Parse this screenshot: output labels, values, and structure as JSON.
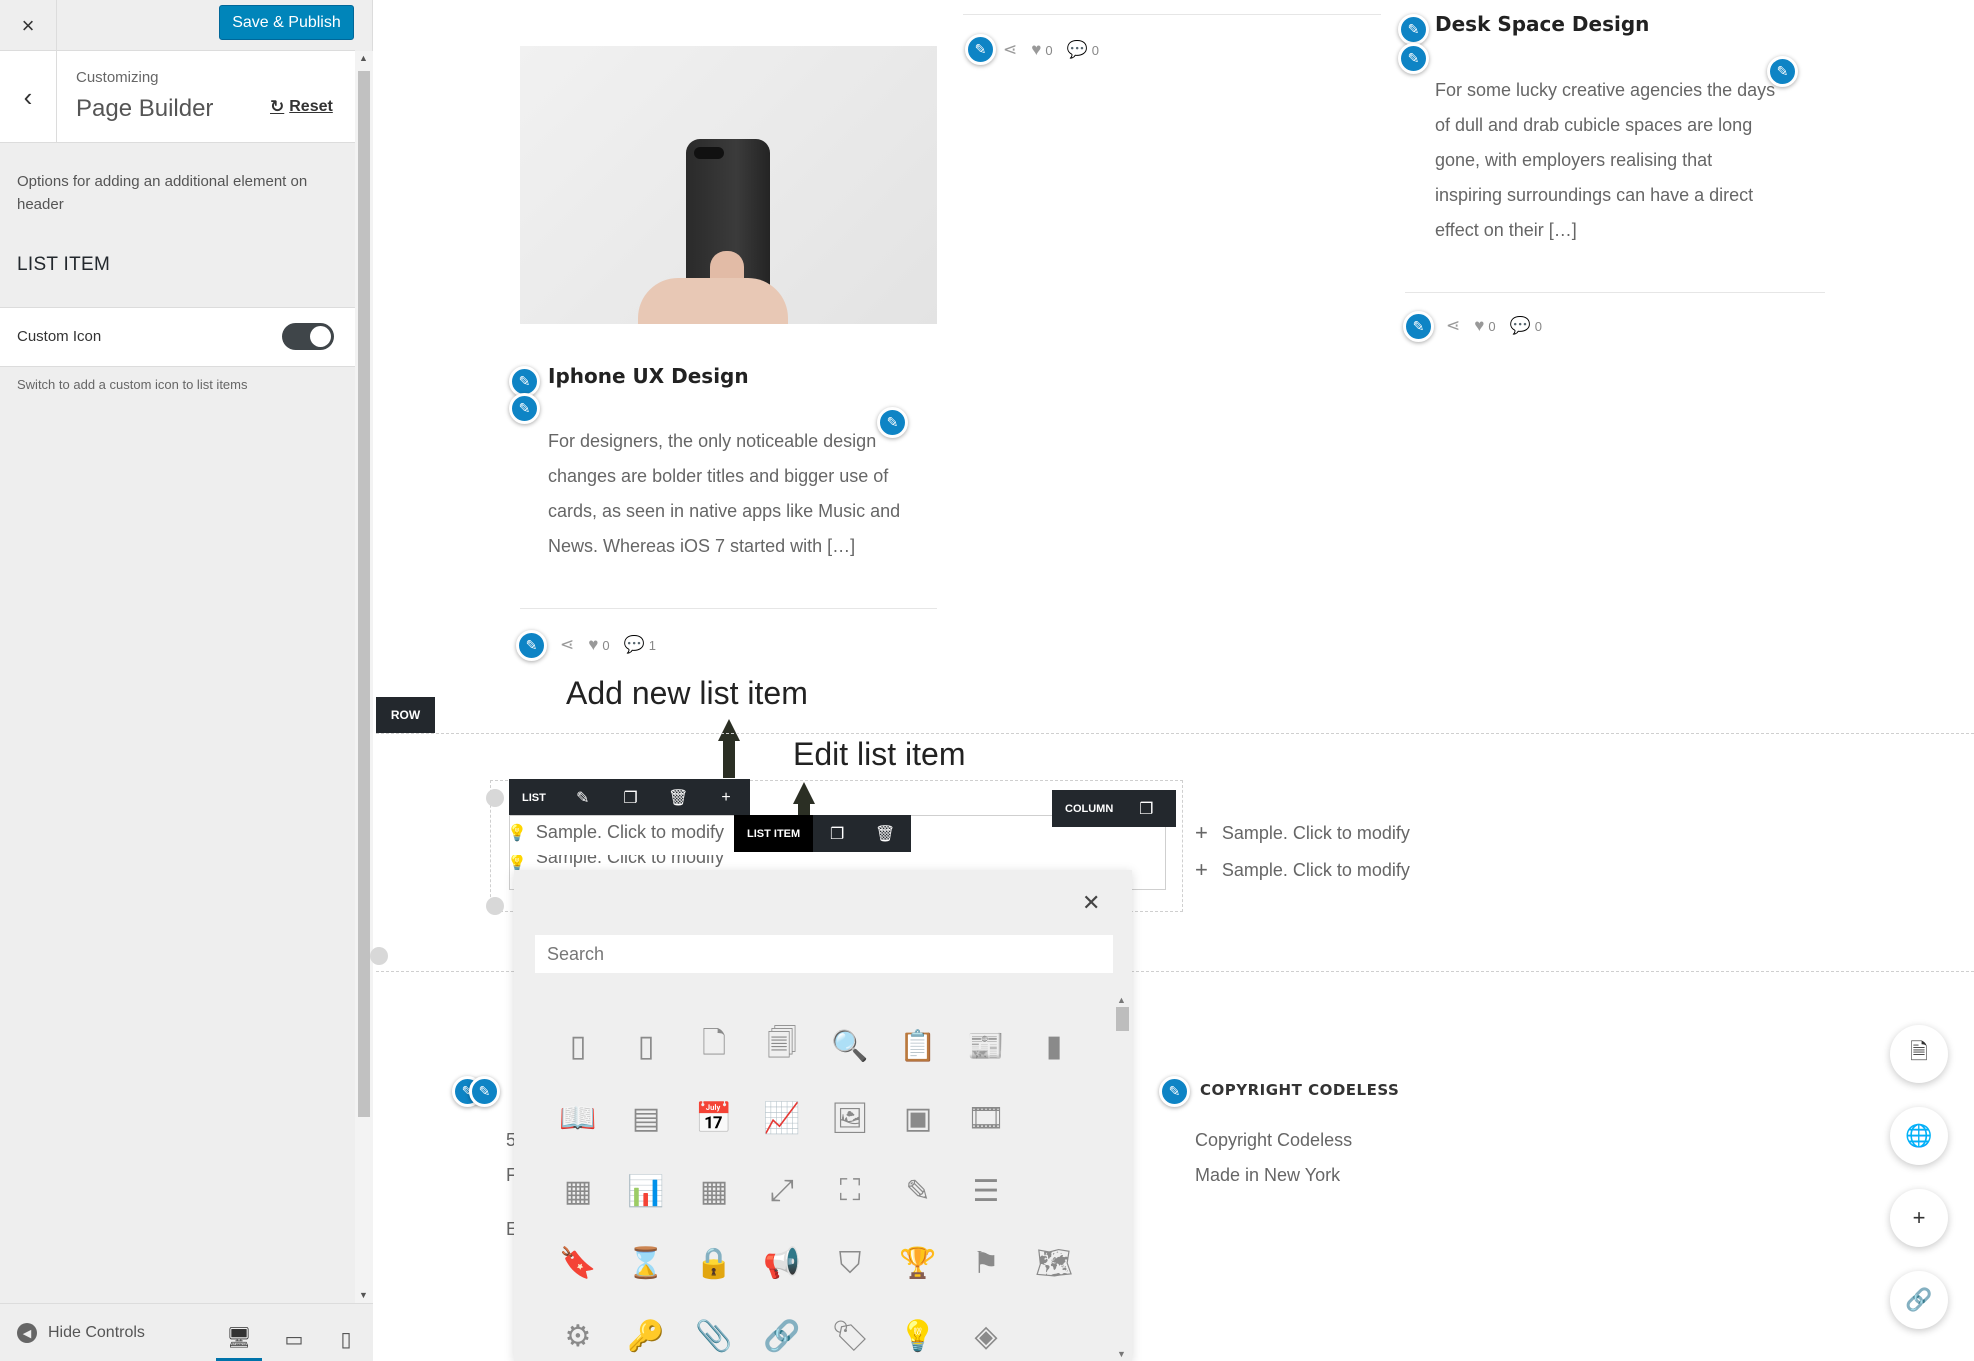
{
  "sidebar": {
    "close_icon": "×",
    "publish_label": "Save & Publish",
    "back_icon": "‹",
    "customizing_label": "Customizing",
    "page_title": "Page Builder",
    "reset_label": "Reset",
    "description": "Options for adding an additional element on header",
    "section_title": "LIST ITEM",
    "option_label": "Custom Icon",
    "option_enabled": true,
    "option_help": "Switch to add a custom icon to list items",
    "hide_controls_label": "Hide Controls",
    "devices": [
      "desktop",
      "tablet",
      "mobile"
    ],
    "active_device": "desktop"
  },
  "posts": [
    {
      "title": "Iphone UX Design",
      "excerpt_lines": [
        "For designers, the only noticeable design",
        "changes are bolder titles and bigger use of",
        "cards, as seen in native apps like Music and",
        "News. Whereas iOS 7 started with […]"
      ],
      "likes": "0",
      "comments": "1"
    },
    {
      "title": "Desk Space Design",
      "excerpt_lines": [
        "For some lucky creative agencies the days",
        "of dull and drab cubicle spaces are long",
        "gone, with employers realising that",
        "inspiring surroundings can have a direct",
        "effect on their […]"
      ],
      "likes": "0",
      "comments": "0"
    },
    {
      "likes": "0",
      "comments": "0"
    }
  ],
  "annotations": {
    "add": "Add new list item",
    "edit": "Edit list item"
  },
  "builder": {
    "row_label": "ROW",
    "list_label": "LIST",
    "list_item_label": "LIST ITEM",
    "column_label": "COLUMN",
    "list_items": [
      "Sample. Click to modify",
      "Sample. Click to modify"
    ],
    "column_items": [
      "Sample. Click to modify",
      "Sample. Click to modify"
    ]
  },
  "icon_picker": {
    "search_placeholder": "Search",
    "icons": [
      {
        "name": "tablet-icon",
        "glyph": "▯"
      },
      {
        "name": "mobile-icon",
        "glyph": "▯"
      },
      {
        "name": "document-icon",
        "glyph": "🗋"
      },
      {
        "name": "documents-icon",
        "glyph": "🗐"
      },
      {
        "name": "document-search-icon",
        "glyph": "🔍"
      },
      {
        "name": "clipboard-icon",
        "glyph": "📋"
      },
      {
        "name": "newspaper-icon",
        "glyph": "📰"
      },
      {
        "name": "notebook-icon",
        "glyph": "▮"
      },
      {
        "name": "book-icon",
        "glyph": "📖"
      },
      {
        "name": "browser-icon",
        "glyph": "▤"
      },
      {
        "name": "calendar-icon",
        "glyph": "📅"
      },
      {
        "name": "presentation-icon",
        "glyph": "📈"
      },
      {
        "name": "image-icon",
        "glyph": "🖼"
      },
      {
        "name": "images-icon",
        "glyph": "▣"
      },
      {
        "name": "video-icon",
        "glyph": "🎞"
      },
      {
        "name": "",
        "glyph": ""
      },
      {
        "name": "blueprint-icon",
        "glyph": "▦"
      },
      {
        "name": "bar-chart-icon",
        "glyph": "📊"
      },
      {
        "name": "table-icon",
        "glyph": "▦"
      },
      {
        "name": "expand-icon",
        "glyph": "⤢"
      },
      {
        "name": "focus-icon",
        "glyph": "⛶"
      },
      {
        "name": "edit-icon",
        "glyph": "✎"
      },
      {
        "name": "sliders-icon",
        "glyph": "☰"
      },
      {
        "name": "",
        "glyph": ""
      },
      {
        "name": "bookmark-icon",
        "glyph": "🔖"
      },
      {
        "name": "hourglass-icon",
        "glyph": "⌛"
      },
      {
        "name": "lock-icon",
        "glyph": "🔒"
      },
      {
        "name": "megaphone-icon",
        "glyph": "📢"
      },
      {
        "name": "shield-icon",
        "glyph": "⛉"
      },
      {
        "name": "trophy-icon",
        "glyph": "🏆"
      },
      {
        "name": "flag-icon",
        "glyph": "⚑"
      },
      {
        "name": "map-icon",
        "glyph": "🗺"
      },
      {
        "name": "gears-icon",
        "glyph": "⚙"
      },
      {
        "name": "key-icon",
        "glyph": "🔑"
      },
      {
        "name": "paperclip-icon",
        "glyph": "📎"
      },
      {
        "name": "link-icon",
        "glyph": "🔗"
      },
      {
        "name": "tags-icon",
        "glyph": "🏷"
      },
      {
        "name": "lightbulb-icon",
        "glyph": "💡"
      },
      {
        "name": "layers-icon",
        "glyph": "◈"
      },
      {
        "name": "",
        "glyph": ""
      }
    ]
  },
  "footer": {
    "heading": "COPYRIGHT CODELESS",
    "lines": [
      "Copyright Codeless",
      "Made in New York"
    ],
    "left_partial": [
      "5",
      "F",
      "E"
    ]
  },
  "fabs": [
    {
      "name": "pages-fab",
      "icon": "page-icon",
      "glyph": "🗎"
    },
    {
      "name": "global-fab",
      "icon": "globe-icon",
      "glyph": "🌐"
    },
    {
      "name": "add-fab",
      "icon": "plus-icon",
      "glyph": "+"
    },
    {
      "name": "link-fab",
      "icon": "link-icon",
      "glyph": "🔗"
    }
  ],
  "colors": {
    "accent": "#0085ba",
    "edit_pen": "#0e84c5",
    "toolbar": "#23282d"
  }
}
